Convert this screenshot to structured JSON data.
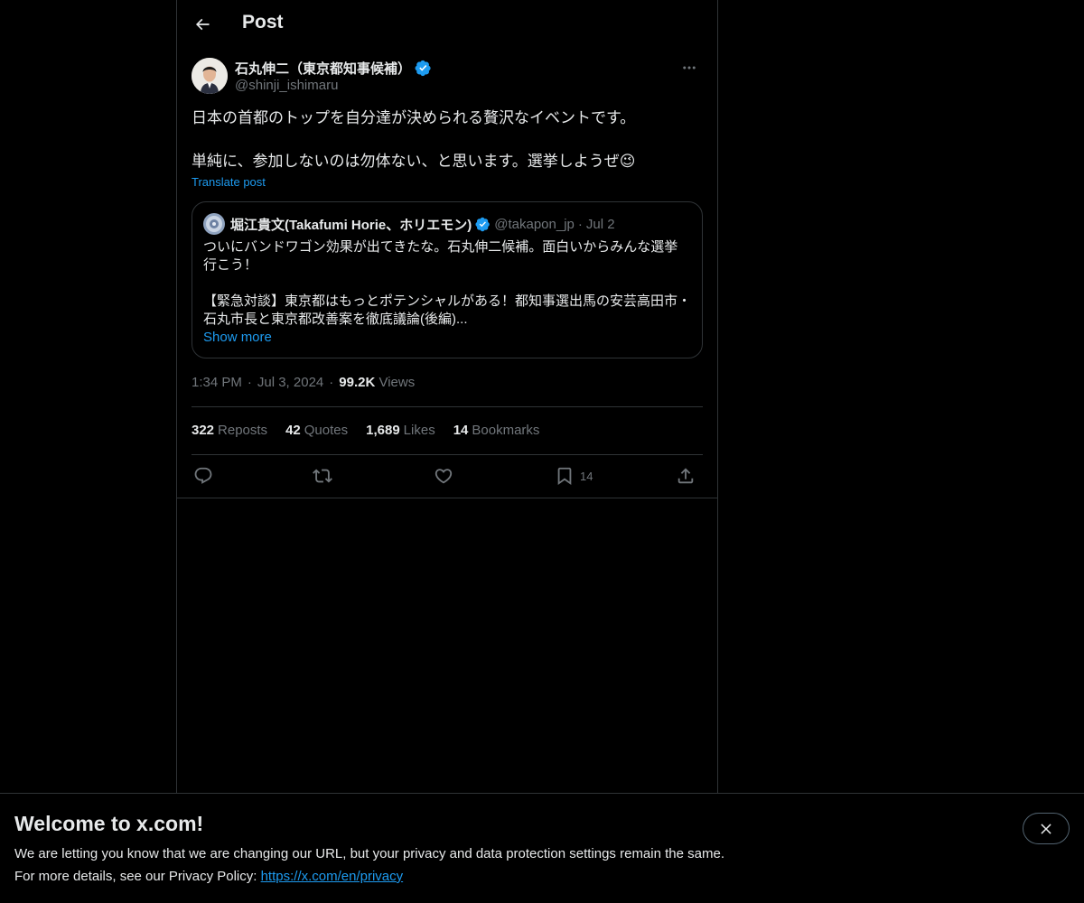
{
  "header": {
    "title": "Post"
  },
  "post": {
    "author": {
      "name": "石丸伸二（東京都知事候補）",
      "handle": "@shinji_ishimaru"
    },
    "text_line1": "日本の首都のトップを自分達が決められる贅沢なイベントです。",
    "text_line2": "単純に、参加しないのは勿体ない、と思います。選挙しようぜ",
    "emoji": "😉",
    "translate_label": "Translate post",
    "quote": {
      "name": "堀江貴文(Takafumi Horie、ホリエモン)",
      "handle": "@takapon_jp",
      "separator": "·",
      "date": "Jul 2",
      "line1": "ついにバンドワゴン効果が出てきたな。石丸伸二候補。面白いからみんな選挙",
      "line2": "行こう！",
      "line3": "【緊急対談】東京都はもっとポテンシャルがある！都知事選出馬の安芸高田市・",
      "line4": "石丸市長と東京都改善案を徹底議論(後編)...",
      "show_more": "Show more"
    },
    "meta": {
      "time": "1:34 PM",
      "dot1": "·",
      "date": "Jul 3, 2024",
      "dot2": "·",
      "views_count": "99.2K",
      "views_label": "Views"
    },
    "stats": [
      {
        "num": "322",
        "label": "Reposts"
      },
      {
        "num": "42",
        "label": "Quotes"
      },
      {
        "num": "1,689",
        "label": "Likes"
      },
      {
        "num": "14",
        "label": "Bookmarks"
      }
    ],
    "actions": {
      "bookmark_count": "14"
    }
  },
  "icons": {
    "back": "arrow-left-icon",
    "verified": "verified-badge-icon",
    "more": "more-horizontal-icon",
    "reply": "reply-icon",
    "repost": "repost-icon",
    "like": "heart-icon",
    "bookmark": "bookmark-icon",
    "share": "share-icon",
    "close": "close-icon"
  },
  "colors": {
    "background": "#000000",
    "text": "#e7e9ea",
    "muted": "#71767b",
    "accent": "#1d9bf0",
    "border": "#2f3336"
  },
  "banner": {
    "title": "Welcome to x.com!",
    "line1": "We are letting you know that we are changing our URL, but your privacy and data protection settings remain the same.",
    "line2_prefix": "For more details, see our Privacy Policy: ",
    "link": "https://x.com/en/privacy"
  }
}
